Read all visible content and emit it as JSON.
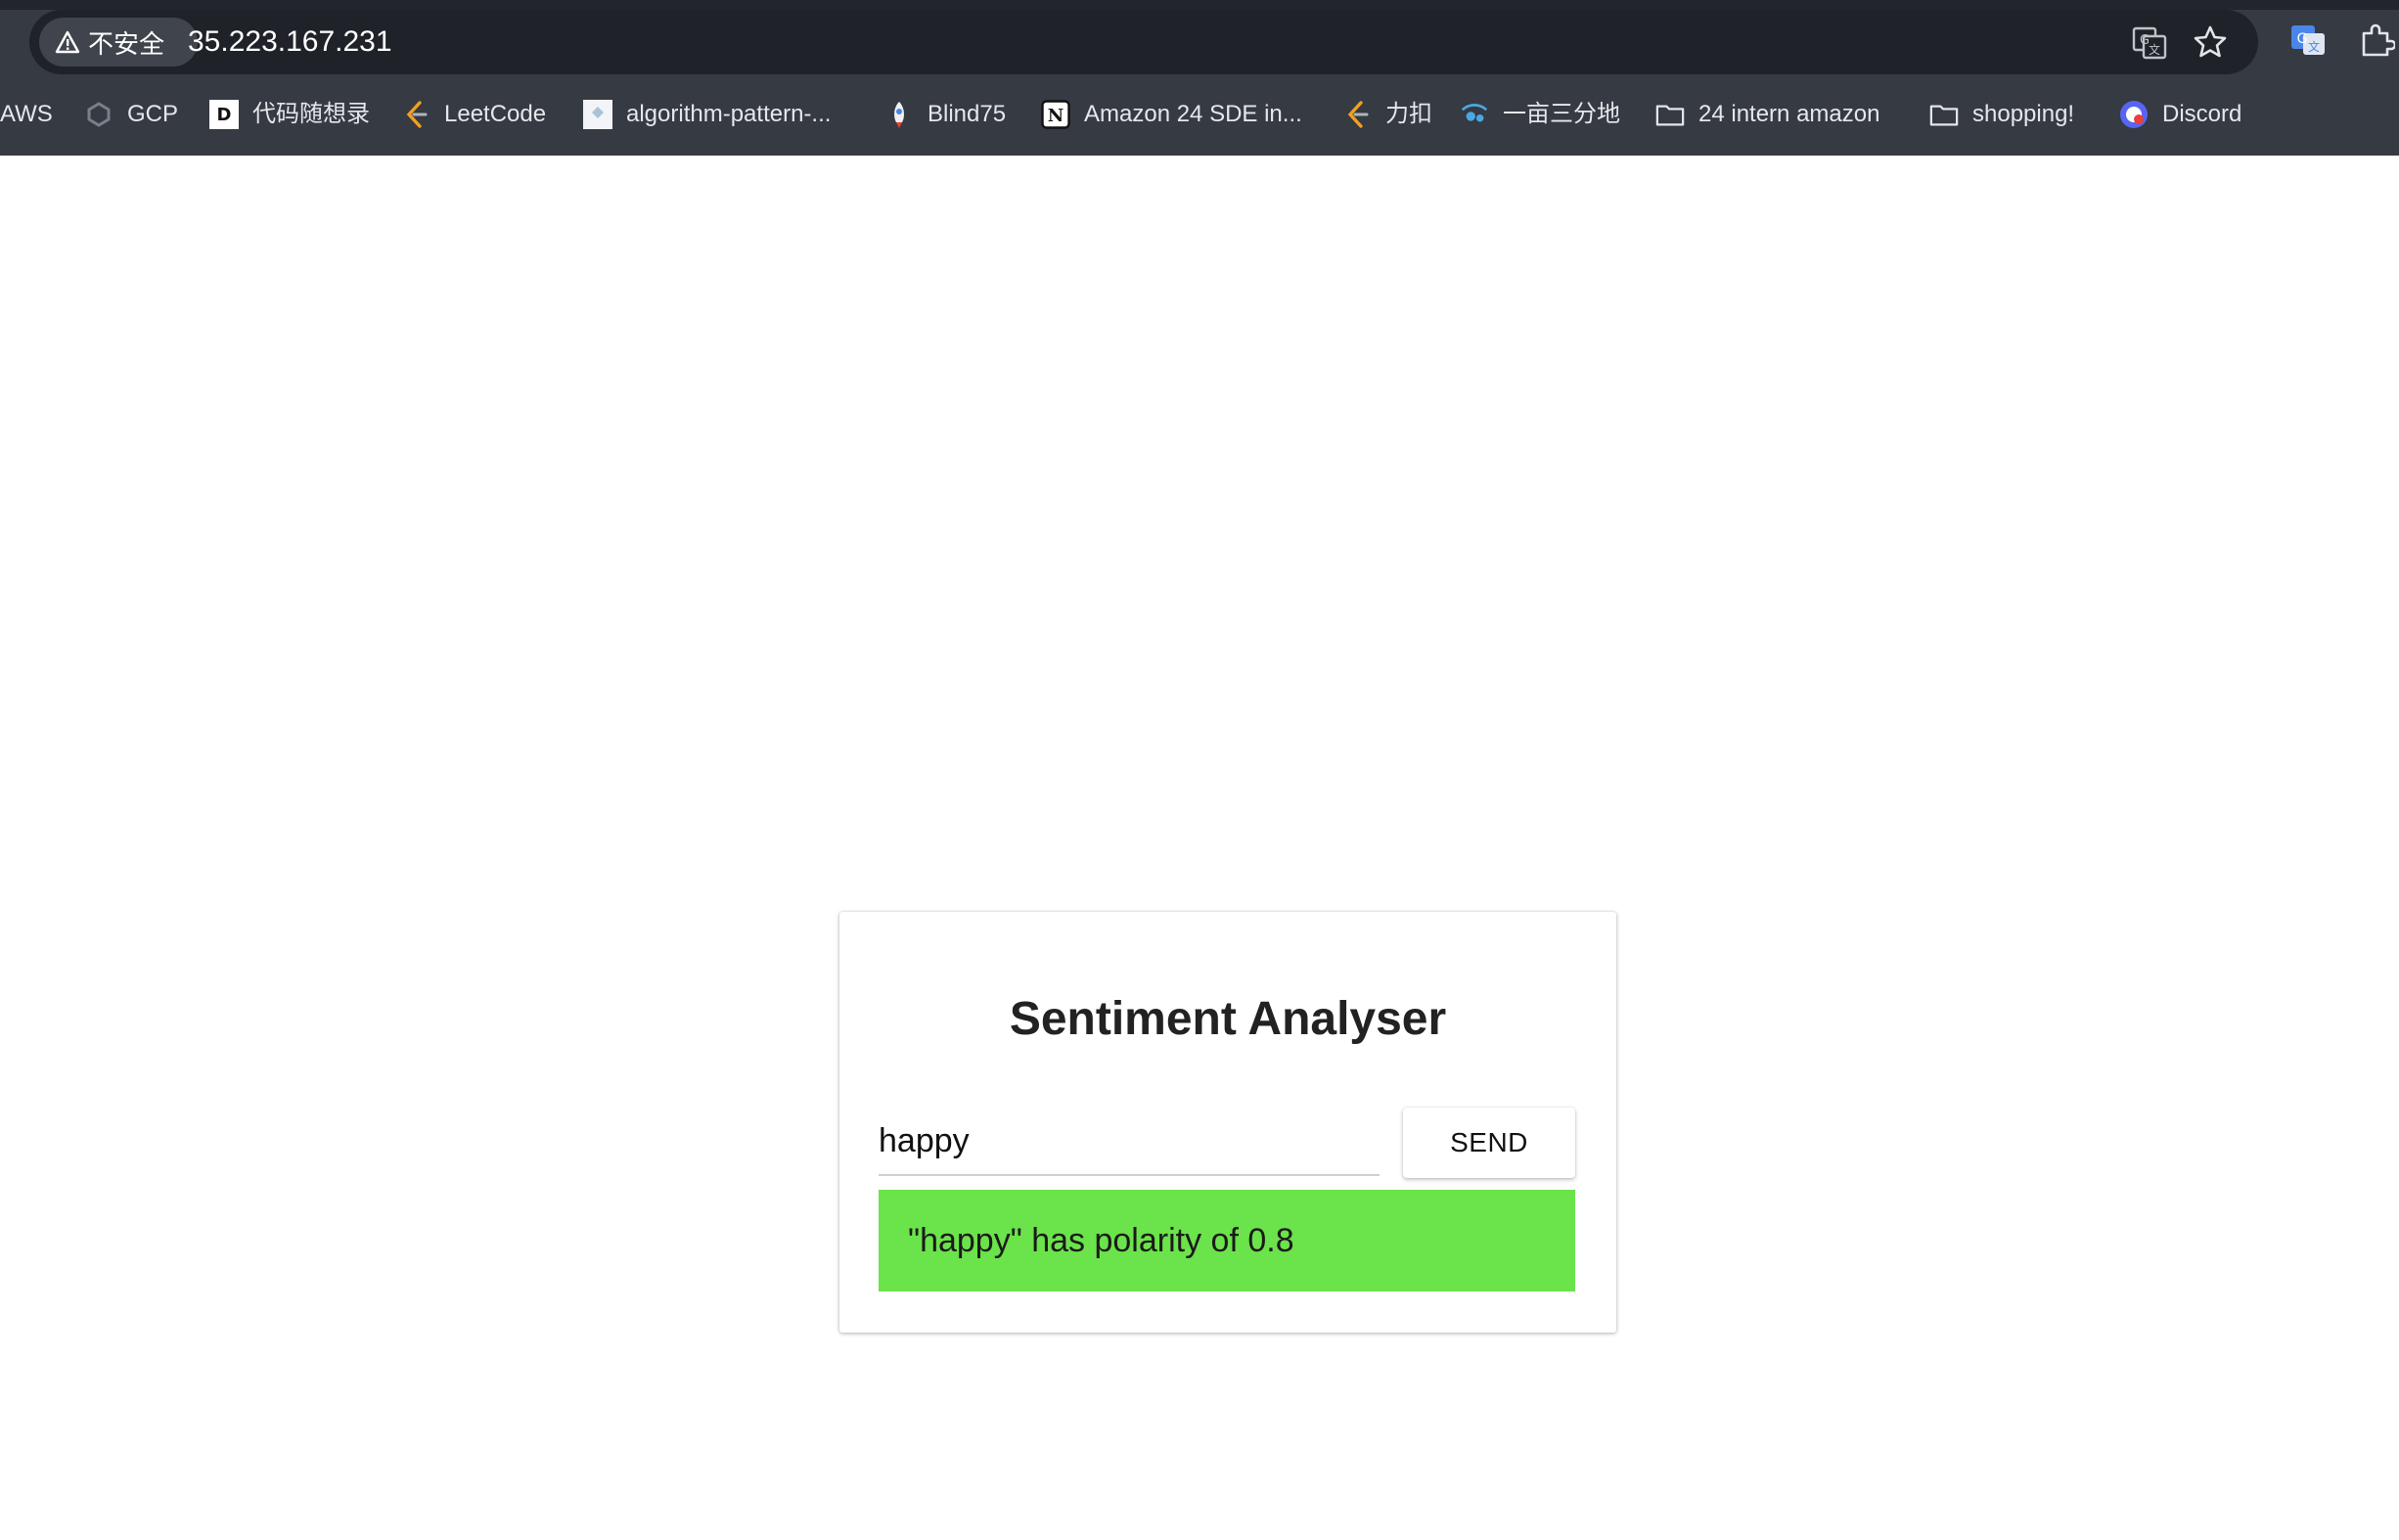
{
  "browser": {
    "security_label": "不安全",
    "url": "35.223.167.231",
    "translate_icon": "translate-icon",
    "bookmark_star_icon": "star-icon",
    "extension_icons": [
      "google-translate-extension-icon",
      "extensions-puzzle-icon"
    ]
  },
  "bookmarks": [
    {
      "label": "AWS",
      "icon": "none"
    },
    {
      "label": "GCP",
      "icon": "gcp-icon"
    },
    {
      "label": "代码随想录",
      "icon": "daima-icon"
    },
    {
      "label": "LeetCode",
      "icon": "leetcode-icon"
    },
    {
      "label": "algorithm-pattern-...",
      "icon": "page-icon"
    },
    {
      "label": "Blind75",
      "icon": "rocket-icon"
    },
    {
      "label": "Amazon 24 SDE in...",
      "icon": "notion-icon"
    },
    {
      "label": "力扣",
      "icon": "leetcode-icon"
    },
    {
      "label": "一亩三分地",
      "icon": "yimu-icon"
    },
    {
      "label": "24 intern amazon",
      "icon": "folder-icon"
    },
    {
      "label": "shopping!",
      "icon": "folder-icon"
    },
    {
      "label": "Discord",
      "icon": "discord-icon"
    }
  ],
  "app": {
    "title": "Sentiment Analyser",
    "input_value": "happy",
    "send_label": "SEND",
    "result_text": "\"happy\" has polarity of 0.8",
    "result_color": "#6be34a"
  },
  "colors": {
    "chrome_bg": "#353a43",
    "omnibox_bg": "#1f2228",
    "card_bg": "#ffffff"
  }
}
